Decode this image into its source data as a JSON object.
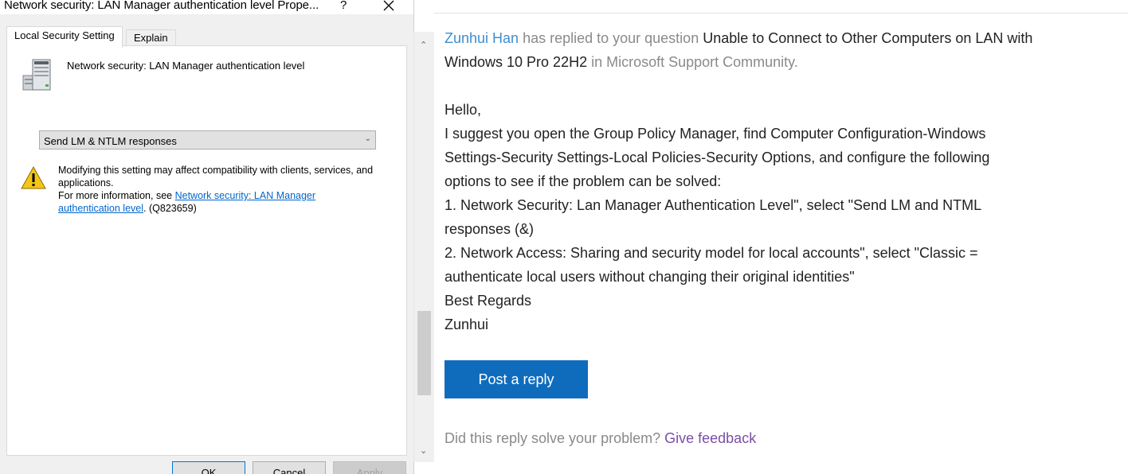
{
  "dialog": {
    "title": "Network security: LAN Manager authentication level Prope...",
    "help_label": "?",
    "tabs": [
      {
        "label": "Local Security Setting"
      },
      {
        "label": "Explain"
      }
    ],
    "policy_name": "Network security: LAN Manager authentication level",
    "selected_option": "Send LM & NTLM responses",
    "warning": {
      "line1": "Modifying this setting may affect compatibility with clients, services, and applications.",
      "more_info_prefix": "For more information, see ",
      "link_text": "Network security: LAN Manager authentication level",
      "suffix": ". (Q823659)"
    },
    "buttons": {
      "ok": "OK",
      "cancel": "Cancel",
      "apply": "Apply"
    }
  },
  "email": {
    "replier": "Zunhui Han",
    "replied_text": " has replied to your question ",
    "question_title": "Unable to Connect to Other Computers on LAN with Windows 10 Pro 22H2",
    "community_text": " in Microsoft Support Community.",
    "body": [
      "Hello,",
      "I suggest you open the Group Policy Manager, find Computer Configuration-Windows Settings-Security Settings-Local Policies-Security Options, and configure the following options to see if the problem can be solved:",
      "1. Network Security: Lan Manager Authentication Level\", select \"Send LM and NTML responses (&)",
      "2. Network Access: Sharing and security model for local accounts\", select \"Classic = authenticate local users without changing their original identities\"",
      "Best Regards",
      "Zunhui"
    ],
    "post_reply_label": "Post a reply",
    "feedback_question": "Did this reply solve your problem? ",
    "feedback_link": "Give feedback"
  },
  "colors": {
    "accent_blue": "#0f6cbd",
    "link_blue": "#3e8ed0",
    "feedback_purple": "#7a4fa8"
  }
}
